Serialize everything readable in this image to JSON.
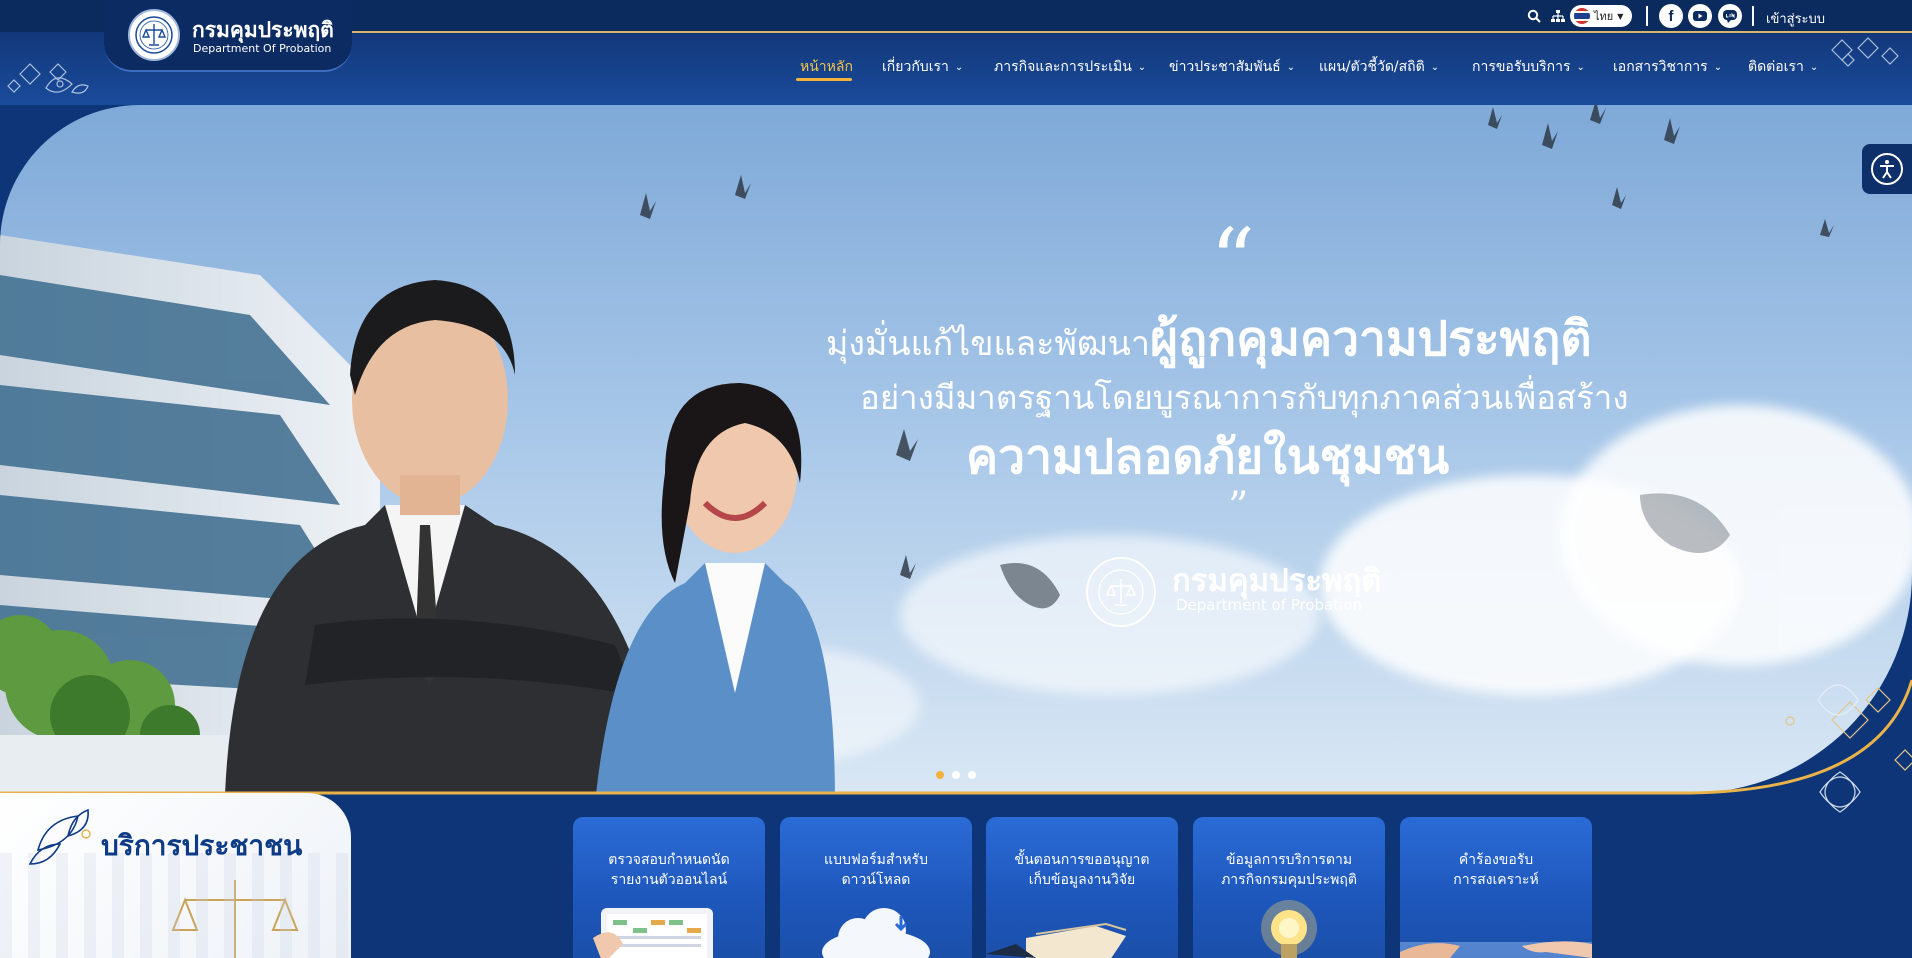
{
  "header": {
    "logo_th": "กรมคุมประพฤติ",
    "logo_en": "Department Of Probation",
    "language": "ไทย",
    "login": "เข้าสู่ระบบ",
    "icons": [
      "search-icon",
      "sitemap-icon",
      "facebook-icon",
      "youtube-icon",
      "line-icon"
    ]
  },
  "nav": [
    {
      "label": "หน้าหลัก",
      "active": true
    },
    {
      "label": "เกี่ยวกับเรา"
    },
    {
      "label": "ภารกิจและการประเมิน"
    },
    {
      "label": "ข่าวประชาสัมพันธ์"
    },
    {
      "label": "แผน/ตัวชี้วัด/สถิติ"
    },
    {
      "label": "การขอรับบริการ"
    },
    {
      "label": "เอกสารวิชาการ"
    },
    {
      "label": "ติดต่อเรา"
    }
  ],
  "hero": {
    "line1_light": "มุ่งมั่นแก้ไขและพัฒนา",
    "line1_bold": "ผู้ถูกคุมความประพฤติ",
    "line2": "อย่างมีมาตรฐานโดยบูรณาการกับทุกภาคส่วนเพื่อสร้าง",
    "line3": "ความปลอดภัยในชุมชน",
    "org_th": "กรมคุมประพฤติ",
    "org_en": "Department of Probation",
    "slides": 3,
    "active_slide": 1
  },
  "services": {
    "title": "บริการประชาชน",
    "cards": [
      {
        "line1": "ตรวจสอบกำหนดนัด",
        "line2": "รายงานตัวออนไลน์"
      },
      {
        "line1": "แบบฟอร์มสำหรับ",
        "line2": "ดาวน์โหลด"
      },
      {
        "line1": "ขั้นตอนการขออนุญาต",
        "line2": "เก็บข้อมูลงานวิจัย"
      },
      {
        "line1": "ข้อมูลการบริการตาม",
        "line2": "ภารกิจกรมคุมประพฤติ"
      },
      {
        "line1": "คำร้องขอรับ",
        "line2": "การสงเคราะห์"
      }
    ]
  },
  "colors": {
    "navy": "#0d3577",
    "gold": "#f3b23a",
    "card": "#2b6bd6"
  }
}
